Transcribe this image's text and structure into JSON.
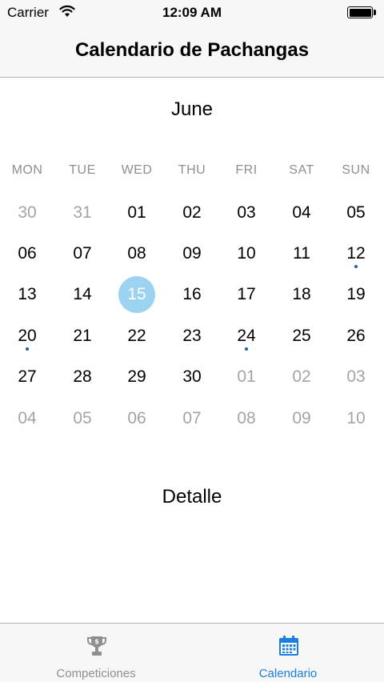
{
  "status_bar": {
    "carrier": "Carrier",
    "time": "12:09 AM",
    "icons": [
      "wifi-icon",
      "battery-icon"
    ]
  },
  "nav": {
    "title": "Calendario de Pachangas"
  },
  "calendar": {
    "month": "June",
    "weekdays": [
      "MON",
      "TUE",
      "WED",
      "THU",
      "FRI",
      "SAT",
      "SUN"
    ],
    "weeks": [
      [
        {
          "d": "30",
          "muted": true
        },
        {
          "d": "31",
          "muted": true
        },
        {
          "d": "01"
        },
        {
          "d": "02"
        },
        {
          "d": "03"
        },
        {
          "d": "04"
        },
        {
          "d": "05"
        }
      ],
      [
        {
          "d": "06"
        },
        {
          "d": "07"
        },
        {
          "d": "08"
        },
        {
          "d": "09"
        },
        {
          "d": "10"
        },
        {
          "d": "11"
        },
        {
          "d": "12",
          "event": true
        }
      ],
      [
        {
          "d": "13"
        },
        {
          "d": "14"
        },
        {
          "d": "15",
          "selected": true
        },
        {
          "d": "16"
        },
        {
          "d": "17"
        },
        {
          "d": "18"
        },
        {
          "d": "19"
        }
      ],
      [
        {
          "d": "20",
          "event": true
        },
        {
          "d": "21"
        },
        {
          "d": "22"
        },
        {
          "d": "23"
        },
        {
          "d": "24",
          "event": true
        },
        {
          "d": "25"
        },
        {
          "d": "26"
        }
      ],
      [
        {
          "d": "27"
        },
        {
          "d": "28"
        },
        {
          "d": "29"
        },
        {
          "d": "30"
        },
        {
          "d": "01",
          "muted": true
        },
        {
          "d": "02",
          "muted": true
        },
        {
          "d": "03",
          "muted": true
        }
      ],
      [
        {
          "d": "04",
          "muted": true
        },
        {
          "d": "05",
          "muted": true
        },
        {
          "d": "06",
          "muted": true
        },
        {
          "d": "07",
          "muted": true
        },
        {
          "d": "08",
          "muted": true
        },
        {
          "d": "09",
          "muted": true
        },
        {
          "d": "10",
          "muted": true
        }
      ]
    ],
    "colors": {
      "selected_bg": "#9bd3f0",
      "event_dot": "#1e5fa8",
      "muted": "#a4a4a8"
    }
  },
  "detail": {
    "title": "Detalle"
  },
  "tab_bar": {
    "tabs": [
      {
        "label": "Competiciones",
        "icon": "trophy-icon",
        "active": false
      },
      {
        "label": "Calendario",
        "icon": "calendar-icon",
        "active": true
      }
    ],
    "colors": {
      "active": "#1a7fe0",
      "inactive": "#8e8e93"
    }
  }
}
